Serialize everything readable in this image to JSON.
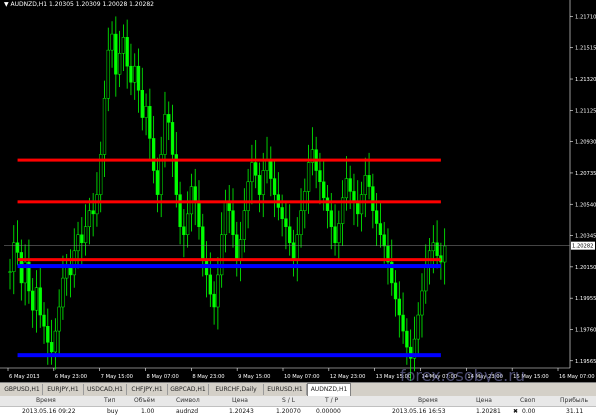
{
  "window": {
    "symbol_title": "AUDNZD,H1  1.20305 1.20309 1.20028 1.20282",
    "current_price_tag": "1.20282"
  },
  "chart_data": {
    "type": "candlestick",
    "symbol": "AUDNZD",
    "timeframe": "H1",
    "ohlc_header": {
      "open": 1.20305,
      "high": 1.20309,
      "low": 1.20028,
      "close": 1.20282
    },
    "ylim": [
      1.1952,
      1.2175
    ],
    "y_ticks": [
      1.2171,
      1.21515,
      1.2132,
      1.21125,
      1.2093,
      1.20735,
      1.2054,
      1.20345,
      1.2015,
      1.19955,
      1.1976,
      1.19565
    ],
    "y_tick_labels": [
      "1.21710",
      "1.21515",
      "1.21320",
      "1.21125",
      "1.20930",
      "1.20735",
      "1.20540",
      "1.20345",
      "1.20150",
      "1.19955",
      "1.19760",
      "1.19565"
    ],
    "x_tick_labels": [
      "6 May 2013",
      "6 May 23:00",
      "7 May 15:00",
      "8 May 07:00",
      "8 May 23:00",
      "9 May 15:00",
      "10 May 07:00",
      "12 May 23:00",
      "13 May 15:00",
      "14 May 07:00",
      "14 May 23:00",
      "15 May 15:00",
      "16 May 07:00"
    ],
    "close_series": [
      1.2012,
      1.203,
      1.2024,
      1.2005,
      1.2018,
      1.2,
      1.1988,
      1.2002,
      1.1985,
      1.1978,
      1.1968,
      1.1962,
      1.1975,
      1.199,
      1.2008,
      1.2015,
      1.201,
      1.2025,
      1.2035,
      1.203,
      1.204,
      1.205,
      1.2048,
      1.206,
      1.2085,
      1.212,
      1.215,
      1.216,
      1.2135,
      1.2148,
      1.2158,
      1.214,
      1.213,
      1.214,
      1.2125,
      1.2108,
      1.2115,
      1.2095,
      1.2075,
      1.206,
      1.2085,
      1.211,
      1.2105,
      1.2085,
      1.206,
      1.204,
      1.2035,
      1.2048,
      1.2065,
      1.2055,
      1.204,
      1.202,
      1.201,
      1.1998,
      1.199,
      1.201,
      1.2035,
      1.2055,
      1.205,
      1.2035,
      1.202,
      1.2032,
      1.205,
      1.2068,
      1.208,
      1.2072,
      1.206,
      1.2075,
      1.2082,
      1.207,
      1.206,
      1.2052,
      1.2045,
      1.204,
      1.203,
      1.202,
      1.2035,
      1.205,
      1.2062,
      1.208,
      1.2088,
      1.2075,
      1.2068,
      1.2058,
      1.205,
      1.204,
      1.203,
      1.2042,
      1.2058,
      1.207,
      1.2062,
      1.2055,
      1.2048,
      1.206,
      1.2072,
      1.2065,
      1.205,
      1.2042,
      1.2035,
      1.2028,
      1.2018,
      1.2005,
      1.1995,
      1.1985,
      1.1975,
      1.1965,
      1.1958,
      1.197,
      1.1985,
      1.2,
      1.2015,
      1.2025,
      1.203,
      1.2022,
      1.2018,
      1.2028
    ],
    "horizontal_levels": [
      {
        "price": 1.20815,
        "color": "#ff0000",
        "x_start_index": 2,
        "x_end_index": 114
      },
      {
        "price": 1.20555,
        "color": "#ff0000",
        "x_start_index": 2,
        "x_end_index": 114
      },
      {
        "price": 1.20195,
        "color": "#ff0000",
        "x_start_index": 2,
        "x_end_index": 114
      },
      {
        "price": 1.20155,
        "color": "#0000ff",
        "x_start_index": 2,
        "x_end_index": 114
      },
      {
        "price": 1.196,
        "color": "#0000ff",
        "x_start_index": 2,
        "x_end_index": 114
      }
    ],
    "current_price": 1.20282,
    "colors": {
      "bull": "#00ff00",
      "bear": "#00ff00",
      "background": "#000000",
      "grid": "#303030",
      "axis_text": "#ffffff"
    }
  },
  "tabs": [
    "GBPUSD,H1",
    "EURJPY,H1",
    "USDCAD,H1",
    "CHFJPY,H1",
    "GBPCAD,H1",
    "EURCHF,Daily",
    "EURUSD,H1",
    "AUDNZD,H1"
  ],
  "active_tab": "AUDNZD,H1",
  "terminal": {
    "headers": [
      "Время",
      "Тип",
      "Объём",
      "Символ",
      "Цена",
      "S / L",
      "T / P",
      "Время",
      "Цена",
      "Своп",
      "Прибыль"
    ],
    "row": [
      "2013.05.16 09:22",
      "buy",
      "1.00",
      "audnzd",
      "1.20243",
      "1.20070",
      "0.00000",
      "2013.05.16 16:53",
      "1.20281",
      "0.00",
      "31.11"
    ]
  },
  "watermark": "forex.osobye.ru"
}
